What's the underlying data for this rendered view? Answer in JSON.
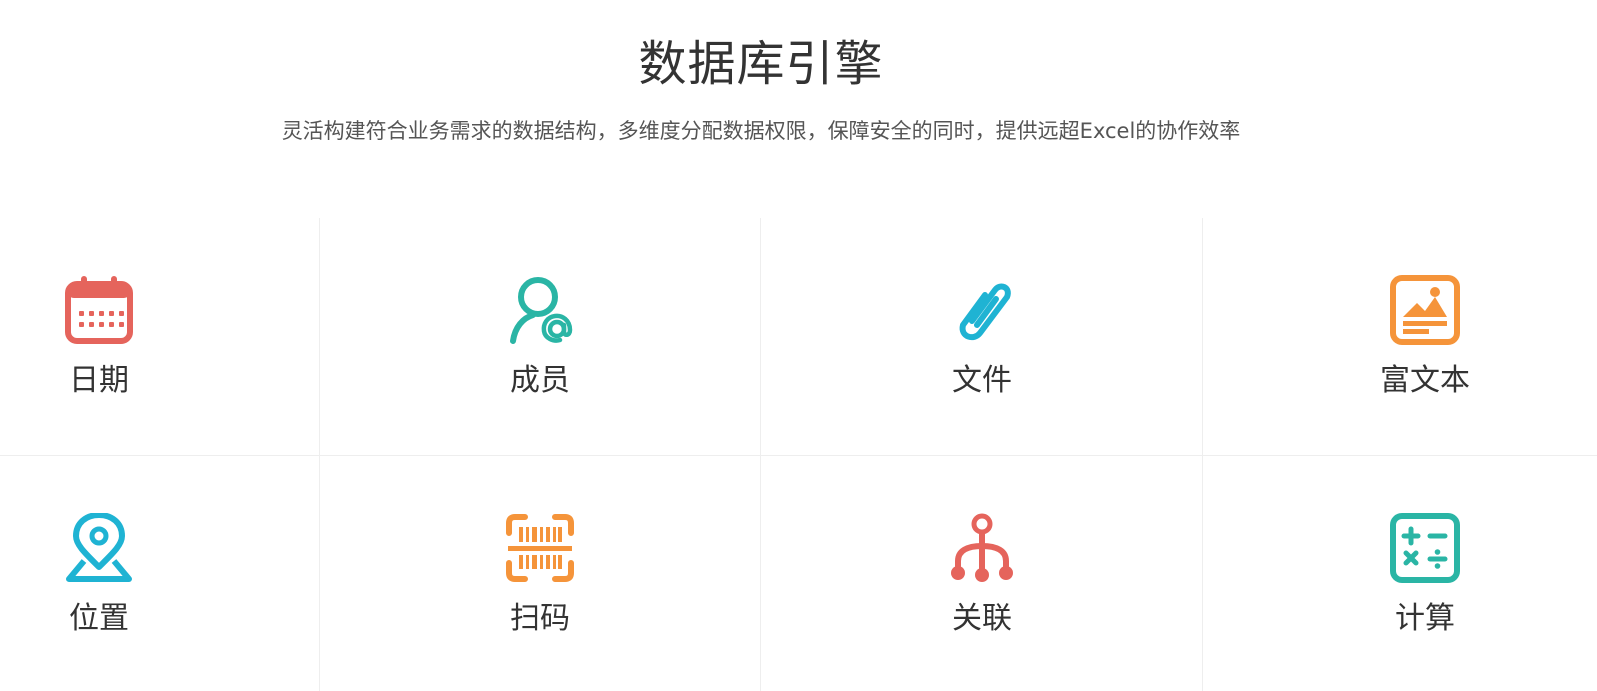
{
  "header": {
    "title": "数据库引擎",
    "subtitle": "灵活构建符合业务需求的数据结构，多维度分配数据权限，保障安全的同时，提供远超Excel的协作效率"
  },
  "features": [
    {
      "label": "日期",
      "icon": "calendar-icon",
      "color": "#e5645c"
    },
    {
      "label": "成员",
      "icon": "member-at-icon",
      "color": "#2ab5a5"
    },
    {
      "label": "文件",
      "icon": "paperclip-icon",
      "color": "#1fb3d3"
    },
    {
      "label": "富文本",
      "icon": "image-text-icon",
      "color": "#f5943a"
    },
    {
      "label": "位置",
      "icon": "location-pin-icon",
      "color": "#1fb3d3"
    },
    {
      "label": "扫码",
      "icon": "barcode-scan-icon",
      "color": "#f5943a"
    },
    {
      "label": "关联",
      "icon": "relation-tree-icon",
      "color": "#e5645c"
    },
    {
      "label": "计算",
      "icon": "calculator-icon",
      "color": "#2ab5a5"
    }
  ]
}
